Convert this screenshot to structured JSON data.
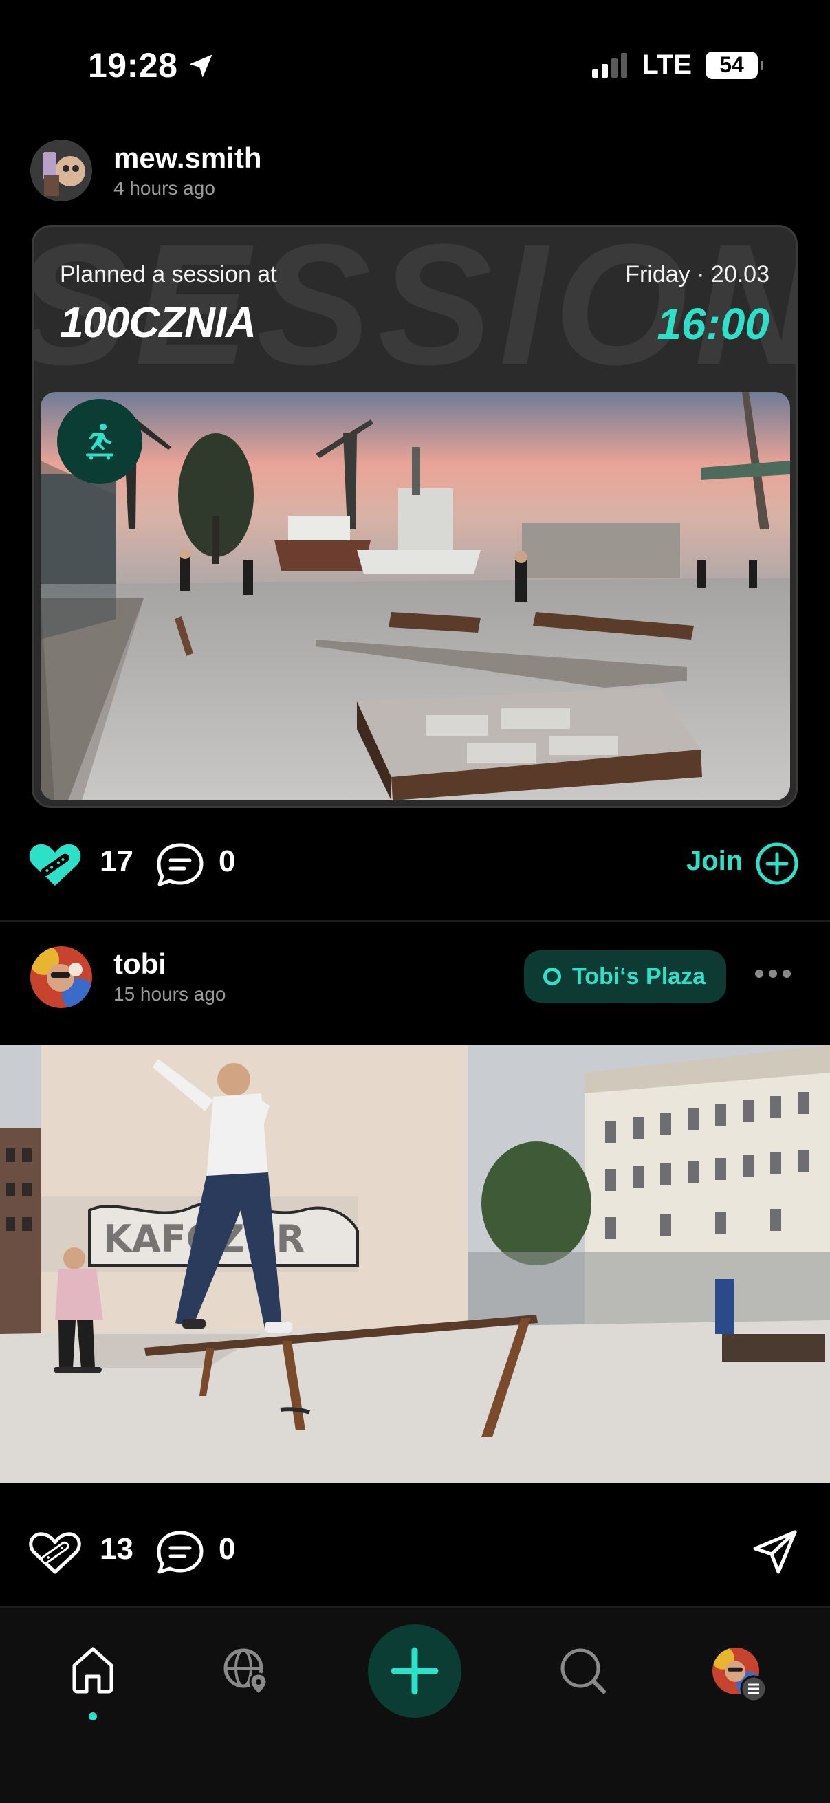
{
  "status_bar": {
    "time": "19:28",
    "network": "LTE",
    "battery": "54"
  },
  "post1": {
    "username": "mew.smith",
    "time_ago": "4 hours ago",
    "card": {
      "background_word": "SESSION",
      "planned_label": "Planned a session at",
      "spot_name": "100CZNIA",
      "date": "Friday · 20.03",
      "time": "16:00"
    },
    "likes": "17",
    "comments": "0",
    "join_label": "Join"
  },
  "post2": {
    "username": "tobi",
    "time_ago": "15 hours ago",
    "location_label": "Tobi‘s Plaza",
    "likes": "13",
    "comments": "0"
  },
  "colors": {
    "accent": "#2de0c8",
    "accent_dark": "#0c3d35",
    "background": "#000000"
  },
  "icons": {
    "status": [
      "location-arrow-icon",
      "signal-icon",
      "battery-icon"
    ],
    "actions": [
      "skateboard-heart-icon",
      "comment-icon",
      "join-plus-icon",
      "share-icon",
      "more-icon"
    ],
    "tabbar": [
      "home-icon",
      "map-globe-icon",
      "add-icon",
      "search-icon",
      "profile-avatar"
    ]
  }
}
